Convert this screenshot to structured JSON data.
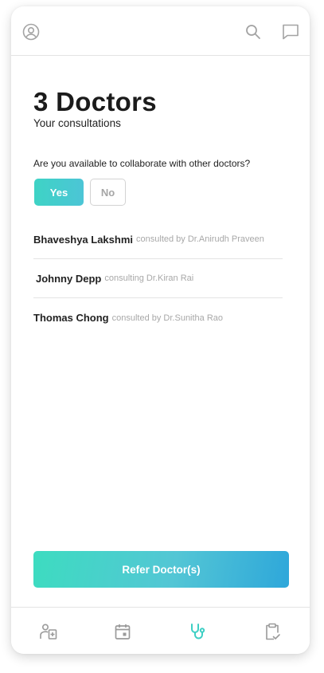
{
  "header": {
    "icons": [
      "profile-icon",
      "search-icon",
      "chat-icon"
    ]
  },
  "main": {
    "title": "3 Doctors",
    "subtitle": "Your consultations",
    "question": "Are you available to collaborate with other doctors?",
    "yes_label": "Yes",
    "no_label": "No",
    "selected": "Yes",
    "consultations": [
      {
        "patient": "Bhaveshya Lakshmi",
        "detail": "consulted by Dr.Anirudh Praveen"
      },
      {
        "patient": "Johnny Depp",
        "detail": "consulting Dr.Kiran Rai"
      },
      {
        "patient": "Thomas Chong",
        "detail": "consulted by Dr.Sunitha Rao"
      }
    ],
    "refer_label": "Refer Doctor(s)"
  },
  "bottom_nav": {
    "items": [
      "doctors-icon",
      "calendar-icon",
      "stethoscope-icon",
      "clipboard-check-icon"
    ],
    "active": "stethoscope-icon"
  },
  "colors": {
    "accent": "#3ecfc4",
    "accent_dark": "#2ea7da",
    "inactive_icon": "#9a9a9a"
  }
}
